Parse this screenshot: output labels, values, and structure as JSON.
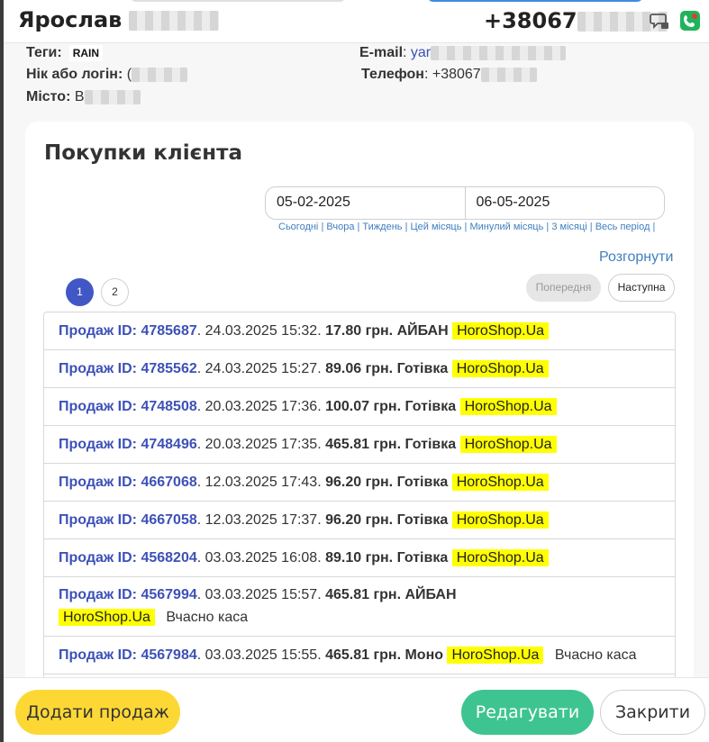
{
  "header": {
    "name": "Ярослав",
    "phone": "+38067"
  },
  "info": {
    "tags_label": "Теги:",
    "tag_value": "RAIN",
    "login_label": "Нік або логін:",
    "login_partial": "(",
    "city_label": "Місто:",
    "city_partial": "В",
    "email_label": "E-mail",
    "email_partial": "yar",
    "phone_label": "Телефон",
    "phone_partial": "+38067"
  },
  "purchases": {
    "title": "Покупки клієнта",
    "date_from": "05-02-2025",
    "date_to": "06-05-2025",
    "periods": [
      "Сьогодні",
      "Вчора",
      "Тиждень",
      "Цей місяць",
      "Минулий місяць",
      "3 місяці",
      "Весь період"
    ],
    "expand_label": "Розгорнути",
    "pages": [
      "1",
      "2"
    ],
    "prev_label": "Попередня",
    "next_label": "Наступна",
    "sales": [
      {
        "id": "Продаж ID: 4785687",
        "datetime": ". 24.03.2025 15:32. ",
        "amount": "17.80 грн. АЙБАН",
        "shop": "HoroShop.Ua",
        "note": ""
      },
      {
        "id": "Продаж ID: 4785562",
        "datetime": ". 24.03.2025 15:27. ",
        "amount": "89.06 грн. Готівка",
        "shop": "HoroShop.Ua",
        "note": ""
      },
      {
        "id": "Продаж ID: 4748508",
        "datetime": ". 20.03.2025 17:36. ",
        "amount": "100.07 грн. Готівка",
        "shop": "HoroShop.Ua",
        "note": ""
      },
      {
        "id": "Продаж ID: 4748496",
        "datetime": ". 20.03.2025 17:35. ",
        "amount": "465.81 грн. Готівка",
        "shop": "HoroShop.Ua",
        "note": ""
      },
      {
        "id": "Продаж ID: 4667068",
        "datetime": ". 12.03.2025 17:43. ",
        "amount": "96.20 грн. Готівка",
        "shop": "HoroShop.Ua",
        "note": ""
      },
      {
        "id": "Продаж ID: 4667058",
        "datetime": ". 12.03.2025 17:37. ",
        "amount": "96.20 грн. Готівка",
        "shop": "HoroShop.Ua",
        "note": ""
      },
      {
        "id": "Продаж ID: 4568204",
        "datetime": ". 03.03.2025 16:08. ",
        "amount": "89.10 грн. Готівка",
        "shop": "HoroShop.Ua",
        "note": ""
      },
      {
        "id": "Продаж ID: 4567994",
        "datetime": ". 03.03.2025 15:57. ",
        "amount": "465.81 грн. АЙБАН",
        "shop": "HoroShop.Ua",
        "note": "Вчасно каса"
      },
      {
        "id": "Продаж ID: 4567984",
        "datetime": ". 03.03.2025 15:55. ",
        "amount": "465.81 грн. Моно",
        "shop": "HoroShop.Ua",
        "note": "Вчасно каса"
      }
    ]
  },
  "footer": {
    "add_sale": "Додати продаж",
    "edit": "Редагувати",
    "close": "Закрити"
  },
  "colors": {
    "accent_blue": "#3d51b8",
    "link_blue": "#3f7fc0",
    "highlight": "#ffff00",
    "add_button": "#fdd835",
    "edit_button": "#3ec491"
  },
  "icons": {
    "phone_comment": "chat-bubble-icon",
    "phone_app": "green-phone-app-icon"
  }
}
